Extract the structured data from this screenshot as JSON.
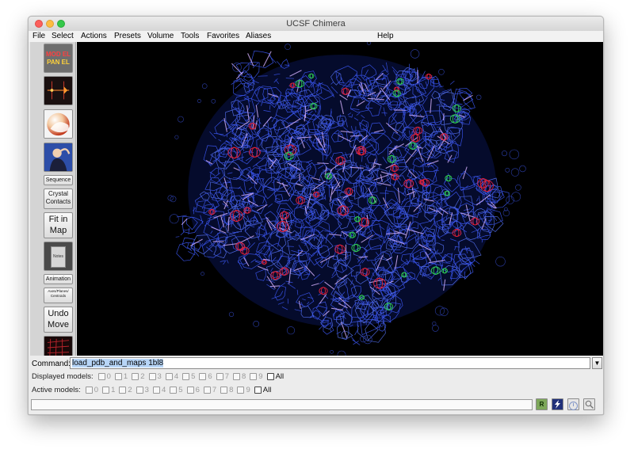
{
  "window": {
    "title": "UCSF Chimera"
  },
  "menubar": {
    "items": [
      {
        "label": "File"
      },
      {
        "label": "Select"
      },
      {
        "label": "Actions"
      },
      {
        "label": "Presets"
      },
      {
        "label": "Volume"
      },
      {
        "label": "Tools"
      },
      {
        "label": "Favorites"
      },
      {
        "label": "Aliases"
      },
      {
        "label": "Help"
      }
    ]
  },
  "toolbar": {
    "model_panel": {
      "line1": "MOD EL",
      "line2": "PAN EL"
    },
    "sequence": "Sequence",
    "crystal_contacts": {
      "line1": "Crystal",
      "line2": "Contacts"
    },
    "fit_in_map": {
      "line1": "Fit in",
      "line2": "Map"
    },
    "notes": "Notes",
    "animation": "Animation",
    "axes_planes": {
      "line1": "Axes/Planes/",
      "line2": "Centroids"
    },
    "undo_move": {
      "line1": "Undo",
      "line2": "Move"
    }
  },
  "command": {
    "label": "Command:",
    "value": "load_pdb_and_maps 1bl8",
    "dropdown_glyph": "▼"
  },
  "displayed_models": {
    "label": "Displayed models:",
    "numbers": [
      "0",
      "1",
      "2",
      "3",
      "4",
      "5",
      "6",
      "7",
      "8",
      "9"
    ],
    "all_label": "All"
  },
  "active_models": {
    "label": "Active models:",
    "numbers": [
      "0",
      "1",
      "2",
      "3",
      "4",
      "5",
      "6",
      "7",
      "8",
      "9"
    ],
    "all_label": "All"
  },
  "status_buttons": {
    "r_label": "R",
    "info_glyph": "i"
  },
  "colors": {
    "viewer_background": "#000000",
    "density_mesh": "#3f5cff",
    "oxygen": "#e0213a",
    "nitrogen": "#2fcf55",
    "bonds": "#d6b2ff"
  }
}
